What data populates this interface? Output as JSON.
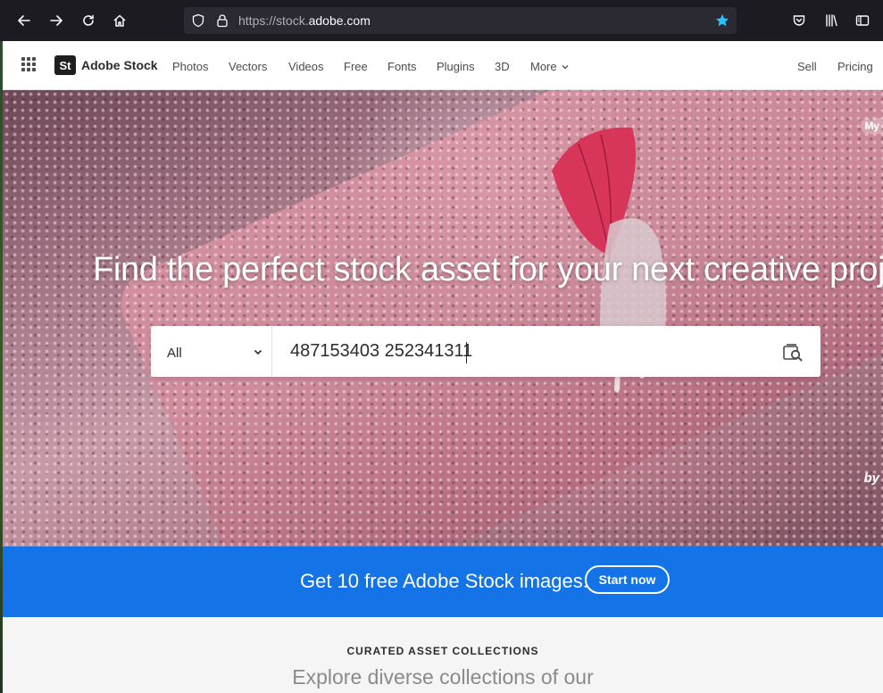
{
  "browser": {
    "url_prefix": "https://stock.",
    "url_domain": "adobe.com",
    "icons": {
      "back": "arrow-left-icon",
      "forward": "arrow-right-icon",
      "reload": "reload-icon",
      "home": "home-icon",
      "tracking": "shield-icon",
      "lock": "lock-icon",
      "bookmark": "star-icon",
      "pocket": "pocket-icon",
      "library": "library-icon",
      "sidebar": "sidebar-icon"
    },
    "colors": {
      "chrome_bg": "#1c1b22",
      "url_bg": "#2b2a33",
      "star": "#2ac3ff"
    }
  },
  "header": {
    "brand_logo": "St",
    "brand_name": "Adobe Stock",
    "nav": [
      "Photos",
      "Vectors",
      "Videos",
      "Free",
      "Fonts",
      "Plugins",
      "3D",
      "More"
    ],
    "right_links": [
      "Sell",
      "Pricing"
    ]
  },
  "hero": {
    "title": "Find the perfect stock asset for your next creative project",
    "edge_label_top": "My",
    "edge_label_by": "by",
    "search": {
      "category": "All",
      "query": "487153403 252341311"
    }
  },
  "promo": {
    "text": "Get 10 free Adobe Stock images.",
    "button": "Start now",
    "color": "#1473e6"
  },
  "curated": {
    "eyebrow": "CURATED ASSET COLLECTIONS",
    "heading": "Explore diverse collections of our"
  }
}
